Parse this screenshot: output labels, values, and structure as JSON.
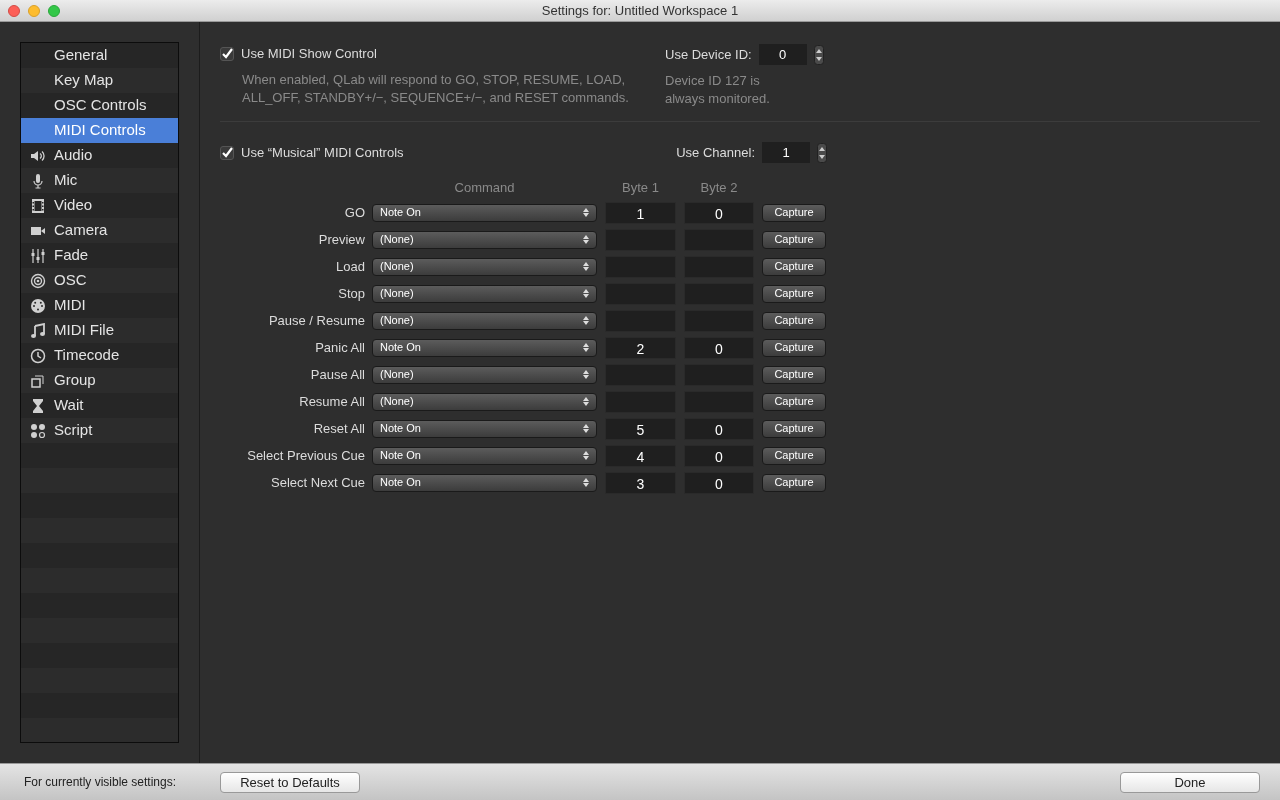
{
  "window": {
    "title": "Settings for: Untitled Workspace 1"
  },
  "sidebar": {
    "items": [
      {
        "label": "General",
        "kind": "page",
        "selected": false
      },
      {
        "label": "Key Map",
        "kind": "page",
        "selected": false
      },
      {
        "label": "OSC Controls",
        "kind": "page",
        "selected": false
      },
      {
        "label": "MIDI Controls",
        "kind": "page",
        "selected": true
      },
      {
        "label": "Audio",
        "kind": "audio",
        "selected": false
      },
      {
        "label": "Mic",
        "kind": "mic",
        "selected": false
      },
      {
        "label": "Video",
        "kind": "video",
        "selected": false
      },
      {
        "label": "Camera",
        "kind": "camera",
        "selected": false
      },
      {
        "label": "Fade",
        "kind": "fade",
        "selected": false
      },
      {
        "label": "OSC",
        "kind": "osc",
        "selected": false
      },
      {
        "label": "MIDI",
        "kind": "midi",
        "selected": false
      },
      {
        "label": "MIDI File",
        "kind": "midifile",
        "selected": false
      },
      {
        "label": "Timecode",
        "kind": "timecode",
        "selected": false
      },
      {
        "label": "Group",
        "kind": "group",
        "selected": false
      },
      {
        "label": "Wait",
        "kind": "wait",
        "selected": false
      },
      {
        "label": "Script",
        "kind": "script",
        "selected": false
      }
    ]
  },
  "msc": {
    "label": "Use MIDI Show Control",
    "checked": true,
    "description": "When enabled, QLab will respond to GO, STOP, RESUME, LOAD, ALL_OFF, STANDBY+/−, SEQUENCE+/−, and RESET commands.",
    "device_id_label": "Use Device ID:",
    "device_id": "0",
    "device_note": "Device ID 127 is always monitored."
  },
  "musical": {
    "label": "Use “Musical” MIDI Controls",
    "checked": true,
    "channel_label": "Use Channel:",
    "channel": "1"
  },
  "table": {
    "columns": [
      "Command",
      "Byte 1",
      "Byte 2"
    ],
    "rows": [
      {
        "name": "GO",
        "command": "Note On",
        "byte1": "1",
        "byte2": "0",
        "button": "Capture"
      },
      {
        "name": "Preview",
        "command": "(None)",
        "button": "Capture"
      },
      {
        "name": "Load",
        "command": "(None)",
        "button": "Capture"
      },
      {
        "name": "Stop",
        "command": "(None)",
        "button": "Capture"
      },
      {
        "name": "Pause / Resume",
        "command": "(None)",
        "button": "Capture"
      },
      {
        "name": "Panic All",
        "command": "Note On",
        "byte1": "2",
        "byte2": "0",
        "button": "Capture"
      },
      {
        "name": "Pause All",
        "command": "(None)",
        "button": "Capture"
      },
      {
        "name": "Resume All",
        "command": "(None)",
        "button": "Capture"
      },
      {
        "name": "Reset All",
        "command": "Note On",
        "byte1": "5",
        "byte2": "0",
        "button": "Capture"
      },
      {
        "name": "Select Previous Cue",
        "command": "Note On",
        "byte1": "4",
        "byte2": "0",
        "button": "Capture"
      },
      {
        "name": "Select Next Cue",
        "command": "Note On",
        "byte1": "3",
        "byte2": "0",
        "button": "Capture"
      }
    ]
  },
  "footer": {
    "label": "For currently visible settings:",
    "reset_button": "Reset to Defaults",
    "done_button": "Done"
  }
}
